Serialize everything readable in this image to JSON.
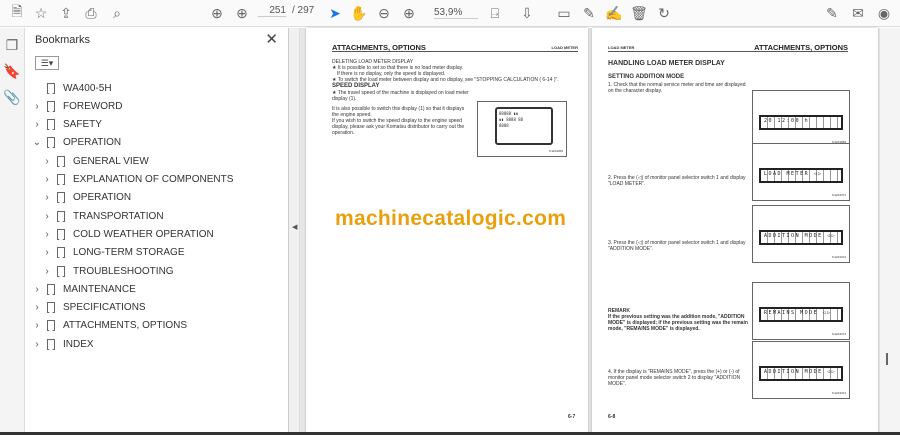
{
  "toolbar": {
    "page_current": "251",
    "page_total": "/ 297",
    "zoom": "53,9%"
  },
  "bookmarks": {
    "title": "Bookmarks",
    "items": [
      {
        "label": "WA400-5H",
        "level": 0,
        "chevron": ""
      },
      {
        "label": "FOREWORD",
        "level": 0,
        "chevron": "›"
      },
      {
        "label": "SAFETY",
        "level": 0,
        "chevron": "›"
      },
      {
        "label": "OPERATION",
        "level": 0,
        "chevron": "⌄"
      },
      {
        "label": "GENERAL VIEW",
        "level": 1,
        "chevron": "›"
      },
      {
        "label": "EXPLANATION OF COMPONENTS",
        "level": 1,
        "chevron": "›"
      },
      {
        "label": "OPERATION",
        "level": 1,
        "chevron": "›"
      },
      {
        "label": "TRANSPORTATION",
        "level": 1,
        "chevron": "›"
      },
      {
        "label": "COLD WEATHER OPERATION",
        "level": 1,
        "chevron": "›"
      },
      {
        "label": "LONG-TERM STORAGE",
        "level": 1,
        "chevron": "›"
      },
      {
        "label": "TROUBLESHOOTING",
        "level": 1,
        "chevron": "›"
      },
      {
        "label": "MAINTENANCE",
        "level": 0,
        "chevron": "›"
      },
      {
        "label": "SPECIFICATIONS",
        "level": 0,
        "chevron": "›"
      },
      {
        "label": "ATTACHMENTS, OPTIONS",
        "level": 0,
        "chevron": "›"
      },
      {
        "label": "INDEX",
        "level": 0,
        "chevron": "›"
      }
    ]
  },
  "left_page": {
    "header": "ATTACHMENTS, OPTIONS",
    "header_right": "LOAD METER",
    "p1": "DELETING LOAD METER DISPLAY",
    "b1": "★ It is possible to set so that there is no load meter display.",
    "b1b": "If there is no display, only the speed is displayed.",
    "b2": "★ To switch the load meter between display and no display, see \"STOPPING CALCULATION ( 6-14 )\".",
    "h2": "SPEED DISPLAY",
    "b3": "★ The travel speed of the machine is displayed on load meter display (1).",
    "p2": "It is also possible to switch this display (1) so that it displays the engine speed.",
    "p3": "If you wish to switch the speed display to the engine speed display, please ask your Komatsu distributor to carry out the operation.",
    "fig_no": "6-WA4069",
    "page_no": "6-7"
  },
  "right_page": {
    "header_left": "LOAD METER",
    "header": "ATTACHMENTS, OPTIONS",
    "h1": "HANDLING LOAD METER DISPLAY",
    "h2": "SETTING ADDITION MODE",
    "s1": "1. Check that the normal service meter and time are displayed on the character display.",
    "s2": "2. Press the (◁) of monitor panel selector switch 1 and display \"LOAD METER\".",
    "s3": "3. Press the (◁) of monitor panel selector switch 1 and display \"ADDITION MODE\".",
    "remark_title": "REMARK",
    "remark": "If the previous setting was the addition mode, \"ADDITION MODE\" is displayed; if the previous setting was the remain mode, \"REMAINS MODE\" is displayed.",
    "s4": "4. If the display is \"REMAINS MODE\", press the (+) or (-) of monitor panel mode selector switch 2 to display \"ADDITION MODE\".",
    "lcd": [
      "20     12:00 h",
      "LOAD METER    ◁▷",
      "ADDITION MODE ◁▷",
      "REMAINS MODE  ◁▷",
      "ADDITION MODE ◁▷"
    ],
    "fig_nos": [
      "6-WA3089",
      "6-WA3471",
      "6-WA3472",
      "6-WA3473",
      "6-WA3474"
    ],
    "page_no": "6-8"
  },
  "watermark": "machinecatalogic.com"
}
